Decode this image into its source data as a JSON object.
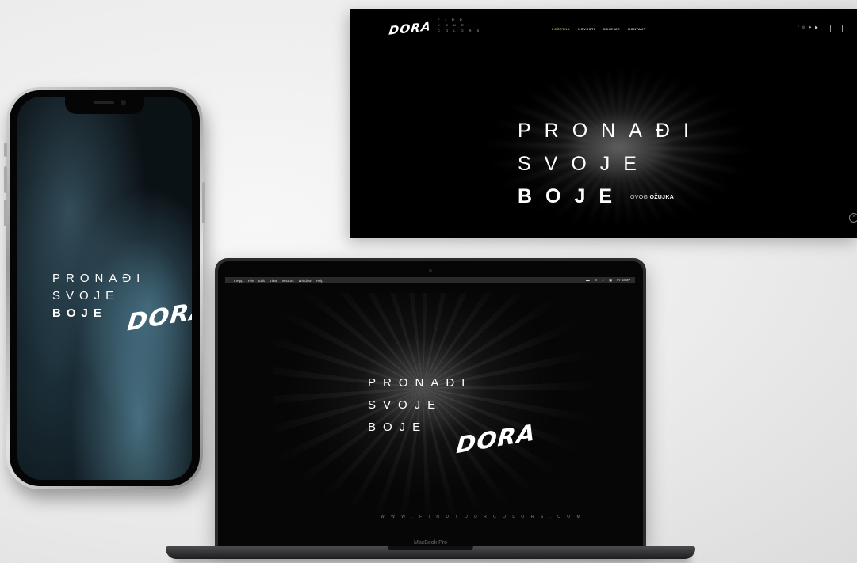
{
  "website": {
    "logo": "DORA",
    "tagline": [
      "F I N D",
      "Y O U R",
      "C O L O R S"
    ],
    "nav": [
      "POČETNA",
      "NOVOSTI",
      "GDJE.ME",
      "KONTAKT"
    ],
    "social_icons": [
      "facebook-icon",
      "instagram-icon",
      "twitter-icon",
      "youtube-icon"
    ],
    "hero": {
      "line1": "PRONAĐI",
      "line2": "SVOJE",
      "line3": "BOJE",
      "date_prefix": "OVOG",
      "date_month": "OŽUJKA"
    },
    "scroll_up": "^"
  },
  "phone": {
    "line1": "PRONAĐI",
    "line2": "SVOJE",
    "line3": "BOJE",
    "logo": "DORA"
  },
  "laptop": {
    "menubar": {
      "app": "InApp",
      "items": [
        "File",
        "Edit",
        "View",
        "Vectors",
        "Window",
        "Help"
      ],
      "clock": "Fr 13:37"
    },
    "hero": {
      "line1": "PRONAĐI",
      "line2": "SVOJE",
      "line3": "BOJE",
      "logo": "DORA"
    },
    "url": "W W W . F I N D Y O U R C O L O R S . C O M",
    "model_label": "MacBook Pro"
  }
}
